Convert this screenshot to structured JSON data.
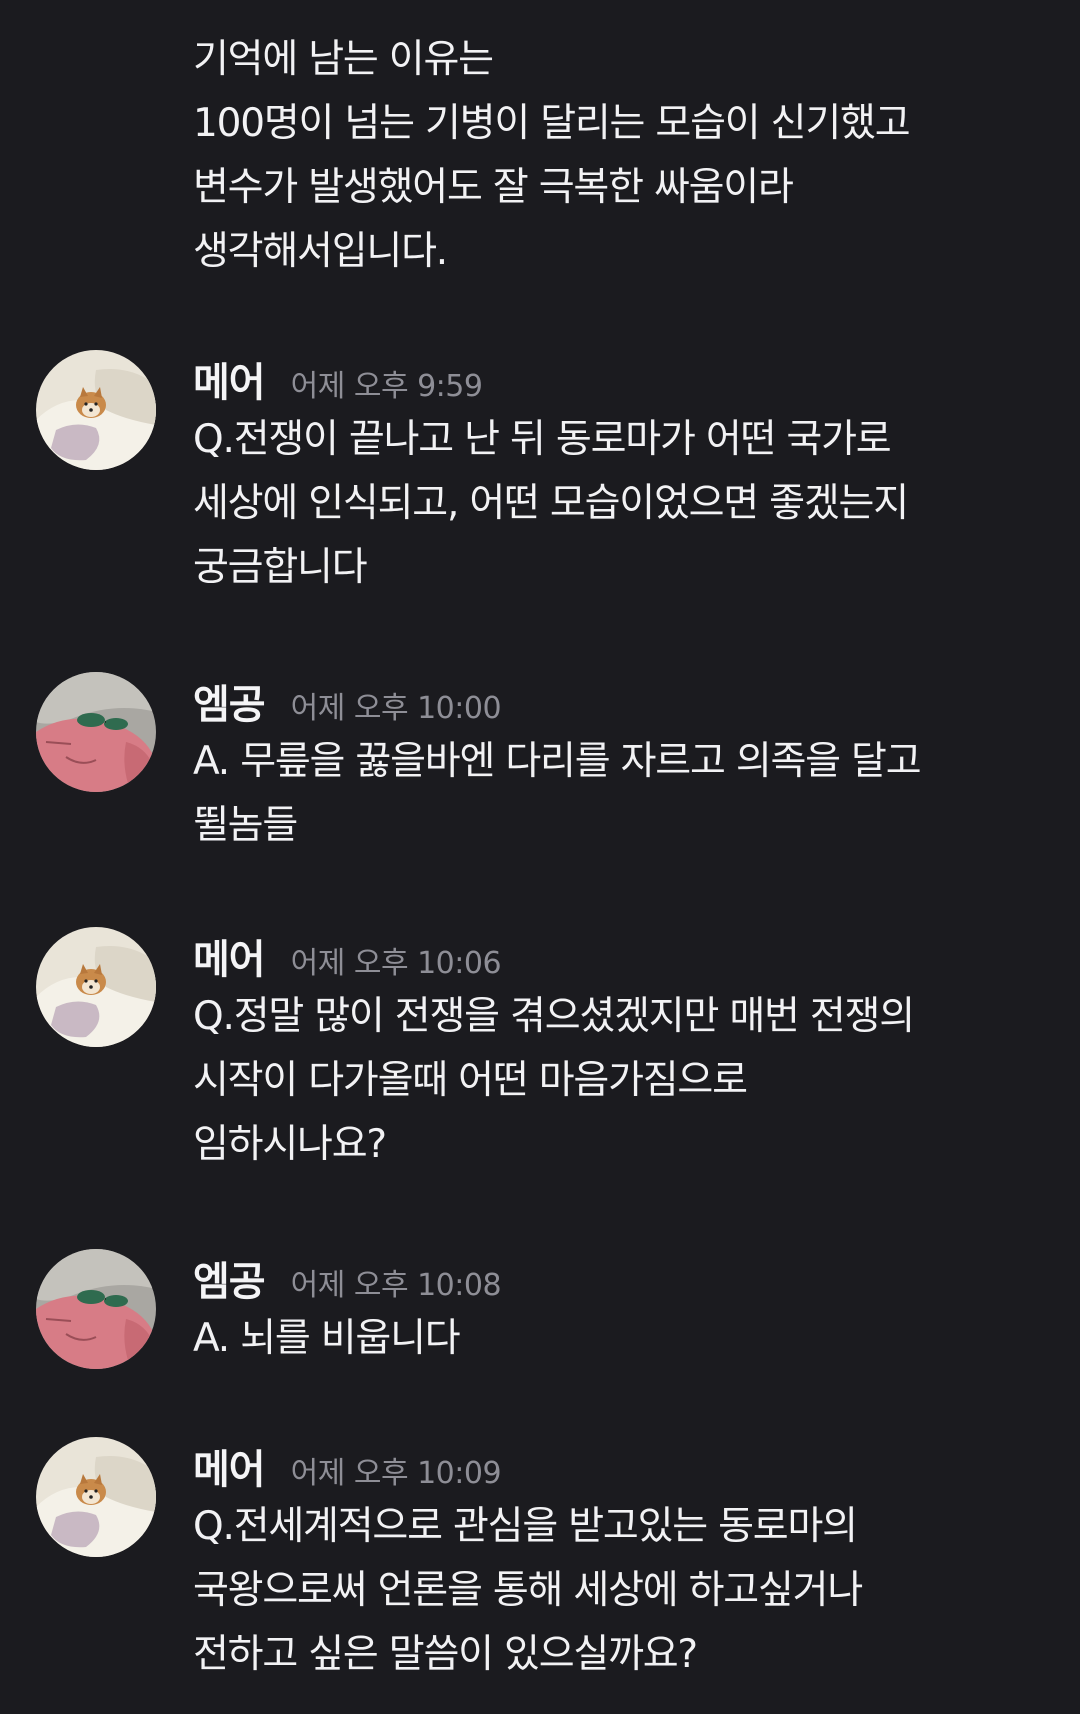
{
  "continuation": {
    "lines": [
      "기억에 남는 이유는",
      "100명이 넘는 기병이 달리는 모습이 신기했고",
      "변수가 발생했어도 잘 극복한 싸움이라",
      "생각해서입니다."
    ]
  },
  "messages": [
    {
      "author": "메어",
      "time": "어제 오후 9:59",
      "avatar": "dog-avatar",
      "lines": [
        "Q.전쟁이 끝나고 난 뒤 동로마가 어떤 국가로",
        "세상에 인식되고, 어떤 모습이었으면 좋겠는지",
        "궁금합니다"
      ]
    },
    {
      "author": "엠공",
      "time": "어제 오후 10:00",
      "avatar": "pink-character-avatar",
      "lines": [
        "A. 무릎을 꿇을바엔 다리를 자르고 의족을 달고",
        "뛸놈들"
      ]
    },
    {
      "author": "메어",
      "time": "어제 오후 10:06",
      "avatar": "dog-avatar",
      "lines": [
        "Q.정말 많이 전쟁을 겪으셨겠지만 매번 전쟁의",
        "시작이 다가올때 어떤 마음가짐으로",
        "임하시나요?"
      ]
    },
    {
      "author": "엠공",
      "time": "어제 오후 10:08",
      "avatar": "pink-character-avatar",
      "lines": [
        "A. 뇌를 비웁니다"
      ]
    },
    {
      "author": "메어",
      "time": "어제 오후 10:09",
      "avatar": "dog-avatar",
      "lines": [
        "Q.전세계적으로 관심을 받고있는 동로마의",
        "국왕으로써 언론을 통해 세상에 하고싶거나",
        "전하고 싶은 말씀이 있으실까요?"
      ]
    }
  ],
  "colors": {
    "background": "#1b1b1f",
    "text": "#f2f2f4",
    "timestamp": "#8e8e96"
  }
}
